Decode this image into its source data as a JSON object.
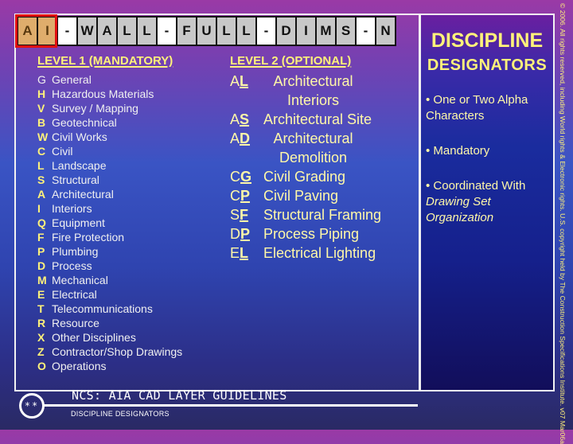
{
  "layer_name_tiles": [
    {
      "char": "A",
      "kind": "highlight"
    },
    {
      "char": "I",
      "kind": "highlight"
    },
    {
      "char": "-",
      "kind": "dash"
    },
    {
      "char": "W",
      "kind": "letter"
    },
    {
      "char": "A",
      "kind": "letter"
    },
    {
      "char": "L",
      "kind": "letter"
    },
    {
      "char": "L",
      "kind": "letter"
    },
    {
      "char": "-",
      "kind": "dash"
    },
    {
      "char": "F",
      "kind": "letter"
    },
    {
      "char": "U",
      "kind": "letter"
    },
    {
      "char": "L",
      "kind": "letter"
    },
    {
      "char": "L",
      "kind": "letter"
    },
    {
      "char": "-",
      "kind": "dash"
    },
    {
      "char": "D",
      "kind": "letter"
    },
    {
      "char": "I",
      "kind": "letter"
    },
    {
      "char": "M",
      "kind": "letter"
    },
    {
      "char": "S",
      "kind": "letter"
    },
    {
      "char": "-",
      "kind": "dash"
    },
    {
      "char": "N",
      "kind": "letter"
    }
  ],
  "level1": {
    "heading": "LEVEL 1 (MANDATORY)",
    "items": [
      {
        "code": "G",
        "label": "General"
      },
      {
        "code": "H",
        "label": "Hazardous Materials"
      },
      {
        "code": "V",
        "label": "Survey / Mapping"
      },
      {
        "code": "B",
        "label": "Geotechnical"
      },
      {
        "code": "W",
        "label": "Civil Works"
      },
      {
        "code": "C",
        "label": "Civil"
      },
      {
        "code": "L",
        "label": "Landscape"
      },
      {
        "code": "S",
        "label": "Structural"
      },
      {
        "code": "A",
        "label": "Architectural"
      },
      {
        "code": "I",
        "label": "Interiors"
      },
      {
        "code": "Q",
        "label": "Equipment"
      },
      {
        "code": "F",
        "label": "Fire Protection"
      },
      {
        "code": "P",
        "label": "Plumbing"
      },
      {
        "code": "D",
        "label": "Process"
      },
      {
        "code": "M",
        "label": "Mechanical"
      },
      {
        "code": "E",
        "label": "Electrical"
      },
      {
        "code": "T",
        "label": "Telecommunications"
      },
      {
        "code": "R",
        "label": "Resource"
      },
      {
        "code": "X",
        "label": "Other Disciplines"
      },
      {
        "code": "Z",
        "label": "Contractor/Shop Drawings"
      },
      {
        "code": "O",
        "label": "Operations"
      }
    ]
  },
  "level2": {
    "heading": "LEVEL 2 (OPTIONAL)",
    "items": [
      {
        "first": "A",
        "second": "L",
        "label": "Architectural Interiors",
        "wrap": true
      },
      {
        "first": "A",
        "second": "S",
        "label": "Architectural Site",
        "wrap": false
      },
      {
        "first": "A",
        "second": "D",
        "label": "Architectural Demolition",
        "wrap": true
      },
      {
        "first": "C",
        "second": "G",
        "label": "Civil Grading",
        "wrap": false
      },
      {
        "first": "C",
        "second": "P",
        "label": "Civil Paving",
        "wrap": false
      },
      {
        "first": "S",
        "second": "F",
        "label": "Structural Framing",
        "wrap": false
      },
      {
        "first": "D",
        "second": "P",
        "label": "Process Piping",
        "wrap": false
      },
      {
        "first": "E",
        "second": "L",
        "label": "Electrical Lighting",
        "wrap": false
      }
    ]
  },
  "right_panel": {
    "title_line1": "DISCIPLINE",
    "title_line2": "DESIGNATORS",
    "bullet1": "• One or Two Alpha Characters",
    "bullet2": "• Mandatory",
    "bullet3_prefix": "• Coordinated With",
    "bullet3_italic": "Drawing Set Organization"
  },
  "footer": {
    "circle_text": "**",
    "title": "NCS: AIA CAD LAYER GUIDELINES",
    "subtitle": "DISCIPLINE DESIGNATORS"
  },
  "copyright": "© 2006. All rights reserved, including World rights & Electronic rights. U.S. copyright held by The Construction Specifications Institute. v07 Mar06a",
  "colors": {
    "heading_yellow": "#fff27a",
    "highlight_tile": "#dfad6c",
    "highlight_border": "#e01010",
    "letter_tile": "#c8c8c8"
  }
}
